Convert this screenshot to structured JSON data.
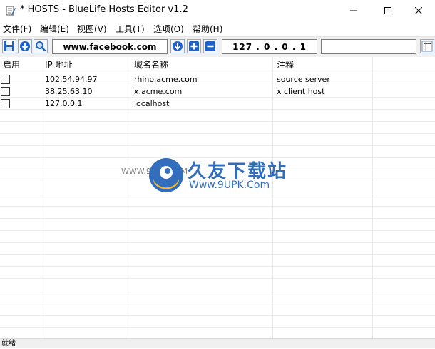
{
  "window": {
    "title": "* HOSTS - BlueLife Hosts Editor v1.2"
  },
  "menu": [
    "文件(F)",
    "编辑(E)",
    "视图(V)",
    "工具(T)",
    "选项(O)",
    "帮助(H)"
  ],
  "toolbar": {
    "domain_value": "www.facebook.com",
    "ip_value": "127 .  0  .  0  .  1",
    "comment_value": ""
  },
  "table": {
    "columns": [
      "启用",
      "IP 地址",
      "域名名称",
      "注释"
    ],
    "rows": [
      {
        "ip": "102.54.94.97",
        "domain": "rhino.acme.com",
        "comment": "source server"
      },
      {
        "ip": "38.25.63.10",
        "domain": "x.acme.com",
        "comment": "x client host"
      },
      {
        "ip": "127.0.0.1",
        "domain": "localhost",
        "comment": ""
      }
    ]
  },
  "watermark": {
    "chinese": "久友下载站",
    "url": "Www.9UPK.Com",
    "small": "WWW.9UPK.COM"
  },
  "status": "就绪"
}
